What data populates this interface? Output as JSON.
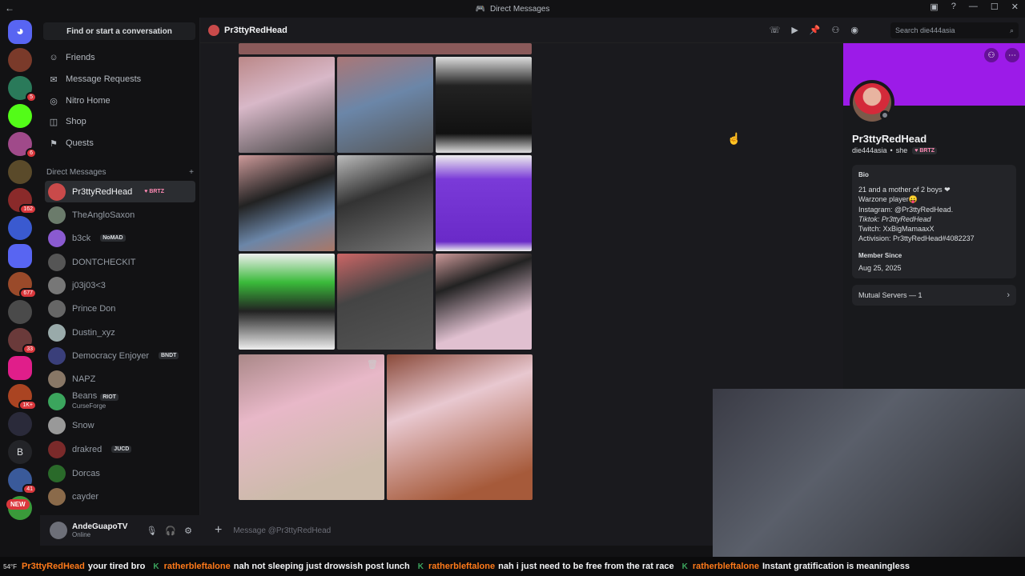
{
  "window": {
    "title": "Direct Messages",
    "back_icon": "arrow-left-icon"
  },
  "guild_badges": [
    "5",
    "6",
    "162",
    "677",
    "33",
    "1K+",
    "41"
  ],
  "guild_letter": "B",
  "new_label": "NEW",
  "sidebar": {
    "find": "Find or start a conversation",
    "nav": [
      {
        "label": "Friends",
        "icon": "friends-icon"
      },
      {
        "label": "Message Requests",
        "icon": "mail-icon"
      },
      {
        "label": "Nitro Home",
        "icon": "nitro-icon"
      },
      {
        "label": "Shop",
        "icon": "shop-icon"
      },
      {
        "label": "Quests",
        "icon": "quests-icon"
      }
    ],
    "dm_header": "Direct Messages",
    "dm_add": "+",
    "dms": [
      {
        "name": "Pr3ttyRedHead",
        "tag": "♥ BRTZ",
        "sub": "",
        "color": "#c94a4a"
      },
      {
        "name": "TheAngloSaxon",
        "tag": "",
        "sub": "",
        "color": "#6b7b6b"
      },
      {
        "name": "b3ck",
        "tag": "NoMAD",
        "sub": "",
        "color": "#8a5ad0"
      },
      {
        "name": "DONTCHECKIT",
        "tag": "",
        "sub": "",
        "color": "#555"
      },
      {
        "name": "j03j03<3",
        "tag": "",
        "sub": "",
        "color": "#777"
      },
      {
        "name": "Prince Don",
        "tag": "",
        "sub": "",
        "color": "#666"
      },
      {
        "name": "Dustin_xyz",
        "tag": "",
        "sub": "",
        "color": "#9aa"
      },
      {
        "name": "Democracy Enjoyer",
        "tag": "BNDT",
        "sub": "",
        "color": "#3a3f7a"
      },
      {
        "name": "NAPZ",
        "tag": "",
        "sub": "",
        "color": "#887766"
      },
      {
        "name": "Beans",
        "tag": "RIOT",
        "sub": "CurseForge",
        "color": "#3ba55d"
      },
      {
        "name": "Snow",
        "tag": "",
        "sub": "",
        "color": "#999"
      },
      {
        "name": "drakred",
        "tag": "JUCD",
        "sub": "",
        "color": "#7a2a2a"
      },
      {
        "name": "Dorcas",
        "tag": "",
        "sub": "",
        "color": "#2a6a2a"
      },
      {
        "name": "cayder",
        "tag": "",
        "sub": "",
        "color": "#8a6a4a"
      }
    ]
  },
  "user": {
    "name": "AndeGuapoTV",
    "status": "Online"
  },
  "chat": {
    "title": "Pr3ttyRedHead",
    "composer_placeholder": "Message @Pr3ttyRedHead"
  },
  "search": {
    "placeholder": "Search die444asia"
  },
  "profile": {
    "name": "Pr3ttyRedHead",
    "username": "die444asia",
    "pronouns": "she",
    "tag": "♥ BRTZ",
    "bio_label": "Bio",
    "bio": [
      "21 and a mother of 2 boys ❤",
      "Warzone player😛",
      "Instagram: @Pr3ttyRedHead.",
      "Tiktok: Pr3ttyRedHead",
      "Twitch: XxBigMamaaxX",
      "Activision: Pr3ttyRedHead#4082237"
    ],
    "member_label": "Member Since",
    "member_date": "Aug 25, 2025",
    "mutual": "Mutual Servers — 1"
  },
  "ticker": [
    {
      "user": "Pr3ttyRedHead",
      "text": "your tired bro"
    },
    {
      "user": "ratherbleftalone",
      "text": "nah not sleeping just drowsish post lunch"
    },
    {
      "user": "ratherbleftalone",
      "text": "nah i just need to be free from the rat race"
    },
    {
      "user": "ratherbleftalone",
      "text": "Instant gratification is meaningless"
    }
  ],
  "weather": "54°F"
}
